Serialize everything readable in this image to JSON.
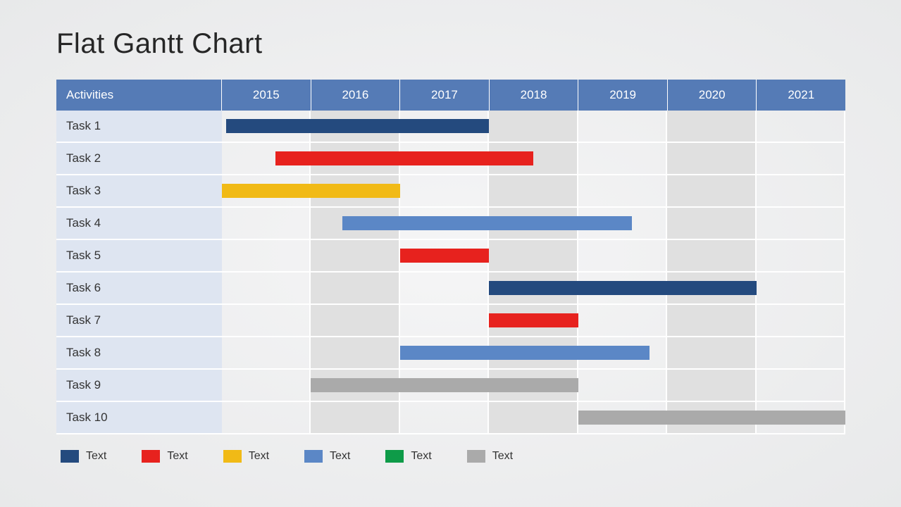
{
  "title": "Flat Gantt Chart",
  "header": {
    "activities_label": "Activities",
    "years": [
      "2015",
      "2016",
      "2017",
      "2018",
      "2019",
      "2020",
      "2021"
    ]
  },
  "colors": {
    "darkblue": "#244A7E",
    "red": "#E7221E",
    "yellow": "#F1BA16",
    "blue": "#5B87C6",
    "green": "#0E9B48",
    "gray": "#AAAAAA"
  },
  "legend": [
    {
      "color": "darkblue",
      "label": "Text"
    },
    {
      "color": "red",
      "label": "Text"
    },
    {
      "color": "yellow",
      "label": "Text"
    },
    {
      "color": "blue",
      "label": "Text"
    },
    {
      "color": "green",
      "label": "Text"
    },
    {
      "color": "gray",
      "label": "Text"
    }
  ],
  "chart_data": {
    "type": "bar",
    "title": "Flat Gantt Chart",
    "xlabel": "",
    "ylabel": "",
    "x_range": [
      2015,
      2022
    ],
    "categories": [
      "Task 1",
      "Task 2",
      "Task 3",
      "Task 4",
      "Task 5",
      "Task 6",
      "Task 7",
      "Task 8",
      "Task 9",
      "Task 10"
    ],
    "series": [
      {
        "name": "Task 1",
        "start": 2015.05,
        "end": 2018.0,
        "color": "darkblue"
      },
      {
        "name": "Task 2",
        "start": 2015.6,
        "end": 2018.5,
        "color": "red"
      },
      {
        "name": "Task 3",
        "start": 2015.0,
        "end": 2017.0,
        "color": "yellow"
      },
      {
        "name": "Task 4",
        "start": 2016.35,
        "end": 2019.6,
        "color": "blue"
      },
      {
        "name": "Task 5",
        "start": 2017.0,
        "end": 2018.0,
        "color": "red"
      },
      {
        "name": "Task 6",
        "start": 2018.0,
        "end": 2021.0,
        "color": "darkblue"
      },
      {
        "name": "Task 7",
        "start": 2018.0,
        "end": 2019.0,
        "color": "red"
      },
      {
        "name": "Task 8",
        "start": 2017.0,
        "end": 2019.8,
        "color": "blue"
      },
      {
        "name": "Task 9",
        "start": 2016.0,
        "end": 2019.0,
        "color": "gray"
      },
      {
        "name": "Task 10",
        "start": 2019.0,
        "end": 2022.0,
        "color": "gray"
      }
    ]
  }
}
